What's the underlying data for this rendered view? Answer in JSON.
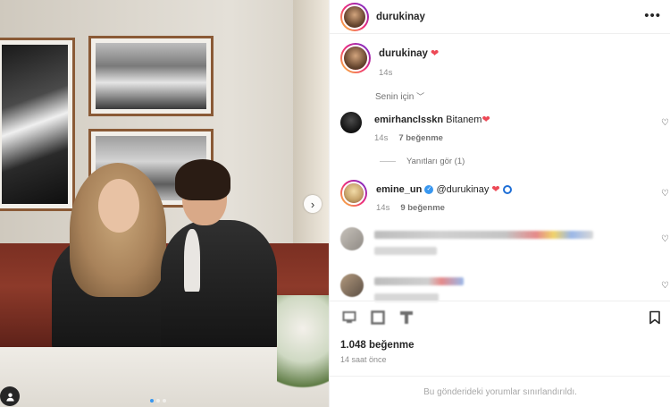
{
  "post": {
    "author": "durukinay",
    "more_label": "•••",
    "caption_heart": "❤",
    "caption_time": "14s",
    "for_you_label": "Senin için",
    "for_you_chevron": "chevron-down-icon",
    "likes": "1.048 beğenme",
    "time_ago": "14 saat önce",
    "comments_limited": "Bu gönderideki yorumlar sınırlandırıldı.",
    "carousel": {
      "total": 3,
      "active": 1
    }
  },
  "comments": [
    {
      "user": "emirhanclsskn",
      "text": "Bitanem",
      "emoji": "❤",
      "time": "14s",
      "likes": "7 beğenme",
      "view_replies": "Yanıtları gör (1)"
    },
    {
      "user": "emine_un",
      "verified": "✓",
      "mention": "@durukinay",
      "emoji": "❤",
      "time": "14s",
      "likes": "9 beğenme"
    }
  ],
  "icons": {
    "like": "heart-icon",
    "comment": "comment-icon",
    "share": "share-icon",
    "save": "bookmark-icon",
    "next": "chevron-right-icon",
    "tag": "user-tag-icon"
  },
  "colors": {
    "heart_red": "#ed4956",
    "verified_blue": "#3897f0",
    "muted": "#8e8e8e"
  }
}
